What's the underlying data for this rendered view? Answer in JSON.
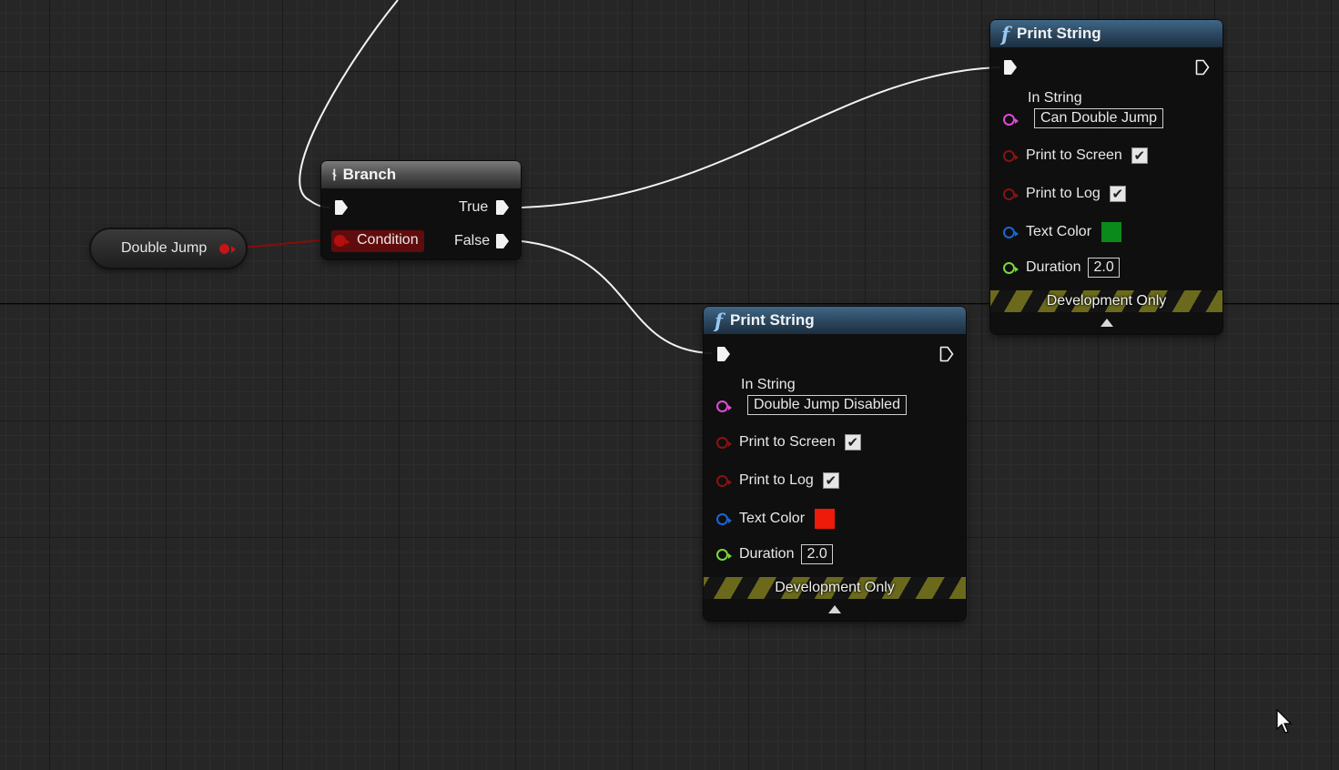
{
  "graph": {
    "variable_node": {
      "label": "Double Jump",
      "pin_color": "#c81414"
    },
    "branch_node": {
      "title": "Branch",
      "icon": "branch-icon",
      "condition_label": "Condition",
      "true_label": "True",
      "false_label": "False"
    },
    "print_nodes": [
      {
        "title": "Print String",
        "icon": "function-icon",
        "in_string_label": "In String",
        "in_string_value": "Can Double Jump",
        "print_to_screen_label": "Print to Screen",
        "print_to_screen_checked": true,
        "print_to_log_label": "Print to Log",
        "print_to_log_checked": true,
        "text_color_label": "Text Color",
        "text_color": "#0a8a1a",
        "duration_label": "Duration",
        "duration_value": "2.0",
        "footer": "Development Only"
      },
      {
        "title": "Print String",
        "icon": "function-icon",
        "in_string_label": "In String",
        "in_string_value": "Double Jump Disabled",
        "print_to_screen_label": "Print to Screen",
        "print_to_screen_checked": true,
        "print_to_log_label": "Print to Log",
        "print_to_log_checked": true,
        "text_color_label": "Text Color",
        "text_color": "#ee1a0a",
        "duration_label": "Duration",
        "duration_value": "2.0",
        "footer": "Development Only"
      }
    ]
  },
  "colors": {
    "exec_wire": "#f2f2f2",
    "bool_wire": "#8a0c0c",
    "string_pin": "#e04ad6",
    "bool_pin": "#8a1212",
    "color_pin": "#1a66d8",
    "float_pin": "#7ad83a"
  }
}
